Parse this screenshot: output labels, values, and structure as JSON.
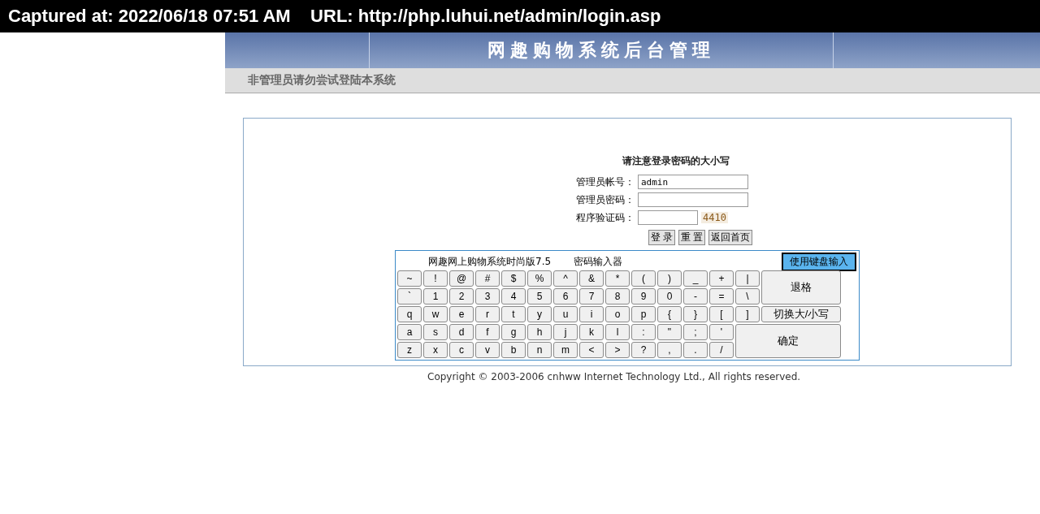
{
  "capture_bar": {
    "text": "Captured at: 2022/06/18 07:51 AM    URL: http://php.luhui.net/admin/login.asp"
  },
  "banner": {
    "title": "网趣购物系统后台管理"
  },
  "notice": "非管理员请勿尝试登陆本系统",
  "login": {
    "heading": "请注意登录密码的大小写",
    "fields": [
      {
        "label": "管理员帐号：",
        "value": "admin"
      },
      {
        "label": "管理员密码："
      }
    ],
    "captcha": {
      "label": "程序验证码：",
      "code": "4410"
    },
    "buttons": [
      "登 录",
      "重 置",
      "返回首页"
    ]
  },
  "keyboard": {
    "caption": "网趣网上购物系统时尚版7.5",
    "title": "密码输入器",
    "toggle": "使用键盘输入",
    "rows": [
      [
        "~",
        "!",
        "@",
        "#",
        "$",
        "%",
        "^",
        "&",
        "*",
        "(",
        ")",
        "_",
        "+",
        "|"
      ],
      [
        "`",
        "1",
        "2",
        "3",
        "4",
        "5",
        "6",
        "7",
        "8",
        "9",
        "0",
        "-",
        "=",
        "\\"
      ],
      [
        "q",
        "w",
        "e",
        "r",
        "t",
        "y",
        "u",
        "i",
        "o",
        "p",
        "{",
        "}",
        "[",
        "]"
      ],
      [
        "a",
        "s",
        "d",
        "f",
        "g",
        "h",
        "j",
        "k",
        "l",
        ":",
        "\"",
        ";",
        "'"
      ],
      [
        "z",
        "x",
        "c",
        "v",
        "b",
        "n",
        "m",
        "<",
        ">",
        "?",
        ",",
        ".",
        "/"
      ]
    ],
    "side_keys": [
      "退格",
      "切换大/小写",
      "确定"
    ]
  },
  "copyright": "Copyright © 2003-2006 cnhww Internet Technology Ltd., All rights reserved."
}
